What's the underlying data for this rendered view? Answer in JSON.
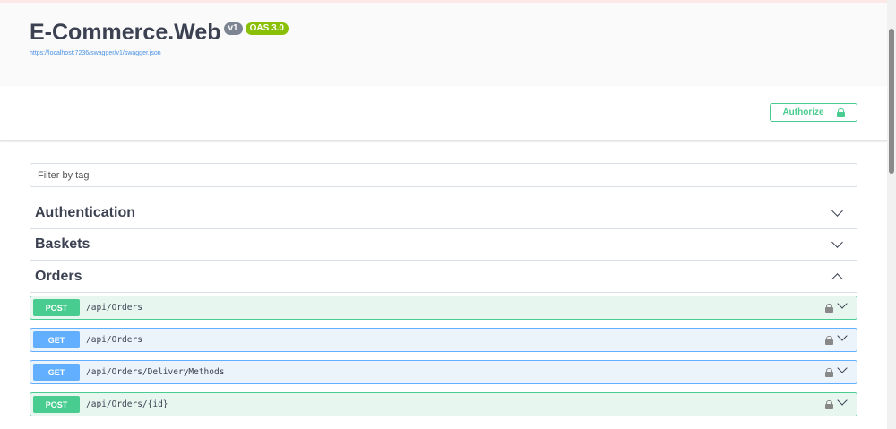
{
  "info": {
    "title": "E-Commerce.Web",
    "version": "v1",
    "oas": "OAS 3.0",
    "url": "https://localhost:7236/swagger/v1/swagger.json"
  },
  "authorize_label": "Authorize",
  "filter_placeholder": "Filter by tag",
  "tags": [
    {
      "name": "Authentication",
      "expanded": false
    },
    {
      "name": "Baskets",
      "expanded": false
    },
    {
      "name": "Orders",
      "expanded": true
    }
  ],
  "operations": [
    {
      "method": "POST",
      "path": "/api/Orders"
    },
    {
      "method": "GET",
      "path": "/api/Orders"
    },
    {
      "method": "GET",
      "path": "/api/Orders/DeliveryMethods"
    },
    {
      "method": "POST",
      "path": "/api/Orders/{id}"
    }
  ],
  "colors": {
    "post": "#49cc90",
    "get": "#61affe"
  }
}
